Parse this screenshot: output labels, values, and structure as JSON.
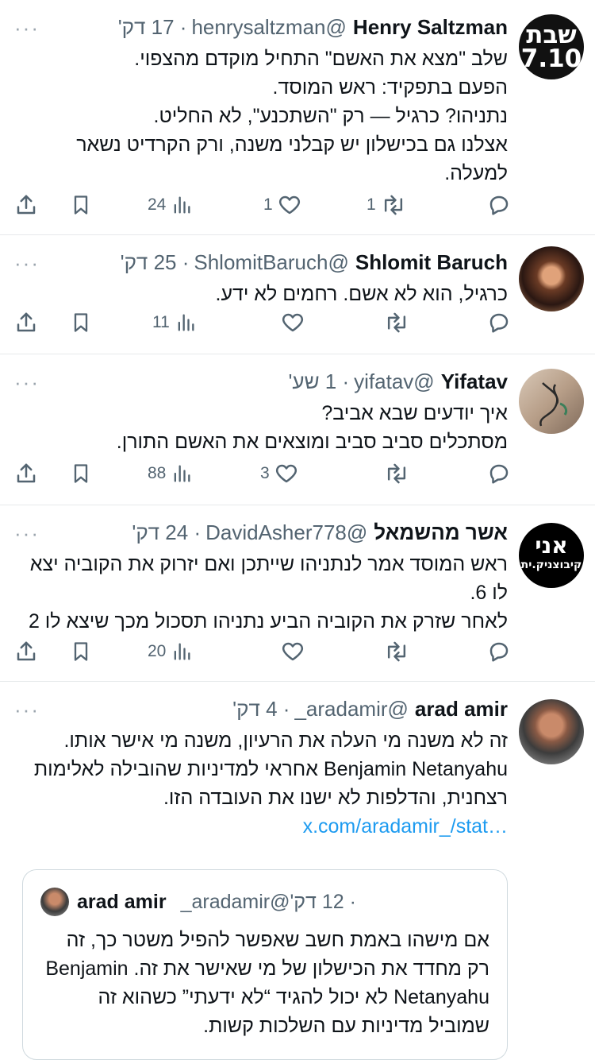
{
  "tweets": [
    {
      "name": "Henry Saltzman",
      "handle": "@henrysaltzman",
      "time": "· 17 דק'",
      "avatar_text": "שבת\n7.10",
      "avatar_line1": "שבת",
      "avatar_line2": "7.10",
      "lines": [
        "שלב \"מצא את האשם\" התחיל מוקדם מהצפוי.",
        "הפעם בתפקיד: ראש המוסד.",
        "נתניהו? כרגיל — רק \"השתכנע\", לא החליט.",
        "אצלנו גם בכישלון יש קבלני משנה, ורק הקרדיט נשאר למעלה."
      ],
      "replies": "",
      "retweets": "1",
      "likes": "1",
      "views": "24"
    },
    {
      "name": "Shlomit Baruch",
      "handle": "@ShlomitBaruch",
      "time": "· 25 דק'",
      "lines": [
        "כרגיל, הוא לא אשם. רחמים לא ידע."
      ],
      "replies": "",
      "retweets": "",
      "likes": "",
      "views": "11"
    },
    {
      "name": "Yifatav",
      "handle": "@yifatav",
      "time": "· 1 שע'",
      "lines": [
        "איך יודעים שבא אביב?",
        "מסתכלים סביב סביב ומוצאים את האשם התורן."
      ],
      "replies": "",
      "retweets": "",
      "likes": "3",
      "views": "88"
    },
    {
      "name": "אשר מהשמאל",
      "handle": "@DavidAsher778",
      "time": "· 24 דק'",
      "avatar_line1": "אני",
      "avatar_line2": "קיבוצניק.ית",
      "lines": [
        "ראש המוסד אמר לנתניהו שייתכן ואם יזרוק את הקוביה יצא לו 6.",
        "לאחר שזרק את הקוביה הביע נתניהו תסכול מכך שיצא לו 2"
      ],
      "replies": "",
      "retweets": "",
      "likes": "",
      "views": "20"
    },
    {
      "name": "arad amir",
      "handle": "@aradamir_",
      "time": "· 4 דק'",
      "lines": [
        "זה לא משנה מי העלה את הרעיון, משנה מי אישר אותו.",
        "Benjamin Netanyahu אחראי למדיניות שהובילה לאלימות רצחנית, והדלפות לא ישנו את העובדה הזו."
      ],
      "link": "x.com/aradamir_/stat…",
      "quote": {
        "name": "arad amir",
        "handle": "@aradamir_",
        "time": "· 12 דק'",
        "lines": [
          "אם מישהו באמת חשב שאפשר להפיל משטר כך, זה רק מחדד את הכישלון של מי שאישר את זה. Benjamin Netanyahu לא יכול להגיד “לא ידעתי” כשהוא זה שמוביל מדיניות עם השלכות קשות."
        ]
      }
    }
  ],
  "more_glyph": "···",
  "colors": {
    "text": "#0f1419",
    "muted": "#536471",
    "link": "#1d9bf0",
    "border": "#e6e9eb"
  }
}
